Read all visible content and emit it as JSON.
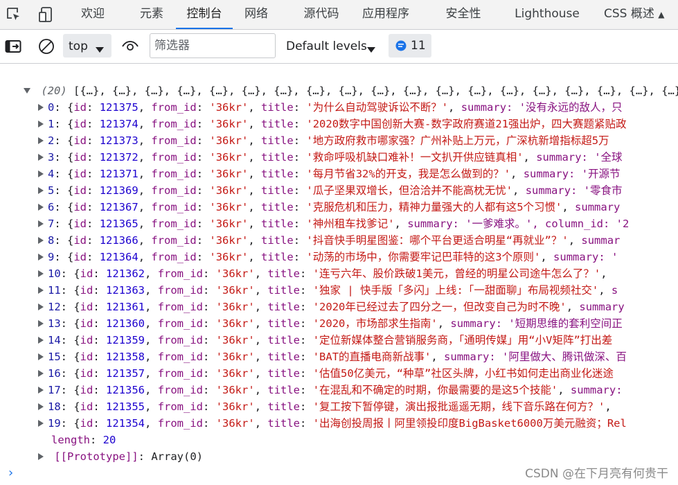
{
  "tabs": [
    {
      "label": "欢迎",
      "active": false
    },
    {
      "label": "元素",
      "active": false
    },
    {
      "label": "控制台",
      "active": true
    },
    {
      "label": "网络",
      "active": false
    },
    {
      "label": "源代码",
      "active": false
    },
    {
      "label": "应用程序",
      "active": false
    },
    {
      "label": "安全性",
      "active": false
    },
    {
      "label": "Lighthouse",
      "active": false
    },
    {
      "label": "CSS 概述",
      "active": false
    }
  ],
  "toolbar": {
    "context": "top",
    "filter_placeholder": "筛选器",
    "levels": "Default levels",
    "issues_count": "11"
  },
  "console": {
    "summary_count": "(20)",
    "summary_preview": "[{…}, {…}, {…}, {…}, {…}, {…}, {…}, {…}, {…}, {…}, {…}, {…}, {…}, {…}, {…}, {…}, {…}, {…}, {…}, {…}]",
    "items": [
      {
        "index": "0",
        "id": "121375",
        "title": "'为什么自动驾驶诉讼不断？'",
        "rest": "summary: '没有永远的敌人，只"
      },
      {
        "index": "1",
        "id": "121374",
        "title": "'2020数字中国创新大赛-数字政府赛道21强出炉，四大赛题紧贴政"
      },
      {
        "index": "2",
        "id": "121373",
        "title": "'地方政府救市哪家强？广州补贴上万元，广深杭新增指标超5万"
      },
      {
        "index": "3",
        "id": "121372",
        "title": "'救命呼吸机缺口难补！一文扒开供应链真相'",
        "rest": "summary: '全球"
      },
      {
        "index": "4",
        "id": "121371",
        "title": "'每月节省32%的开支，我是怎么做到的？'",
        "rest": "summary: '开源节"
      },
      {
        "index": "5",
        "id": "121369",
        "title": "'瓜子坚果双增长，但洽洽并不能高枕无忧'",
        "rest": "summary: '零食市"
      },
      {
        "index": "6",
        "id": "121367",
        "title": "'克服危机和压力，精神力量强大的人都有这5个习惯'",
        "rest": "summary"
      },
      {
        "index": "7",
        "id": "121365",
        "title": "'神州租车找爹记'",
        "rest": "summary: '一爹难求。', column_id: '2"
      },
      {
        "index": "8",
        "id": "121366",
        "title": "'抖音快手明星图鉴：哪个平台更适合明星“再就业”？'",
        "rest": "summar"
      },
      {
        "index": "9",
        "id": "121364",
        "title": "'动荡的市场中，你需要牢记巴菲特的这3个原则'",
        "rest": "summary: '"
      },
      {
        "index": "10",
        "id": "121362",
        "title": "'连亏六年、股价跌破1美元，曾经的明星公司途牛怎么了？'",
        "rest": ""
      },
      {
        "index": "11",
        "id": "121363",
        "title": "'独家 | 快手版「多闪」上线:「一甜面聊」布局视频社交'",
        "rest": "s"
      },
      {
        "index": "12",
        "id": "121361",
        "title": "'2020年已经过去了四分之一，但改变自己为时不晚'",
        "rest": "summary"
      },
      {
        "index": "13",
        "id": "121360",
        "title": "'2020，市场部求生指南'",
        "rest": "summary: '短期思维的套利空间正"
      },
      {
        "index": "14",
        "id": "121359",
        "title": "'定位新媒体整合营销服务商，「通明传媒」用“小V矩阵”打出差"
      },
      {
        "index": "15",
        "id": "121358",
        "title": "'BAT的直播电商新战事'",
        "rest": "summary: '阿里做大、腾讯做深、百"
      },
      {
        "index": "16",
        "id": "121357",
        "title": "'估值50亿美元，“种草”社区头牌，小红书如何走出商业化迷途"
      },
      {
        "index": "17",
        "id": "121356",
        "title": "'在混乱和不确定的时期，你最需要的是这5个技能'",
        "rest": "summary:"
      },
      {
        "index": "18",
        "id": "121355",
        "title": "'复工按下暂停键，演出报批遥遥无期，线下音乐路在何方？'",
        "rest": ""
      },
      {
        "index": "19",
        "id": "121354",
        "title": "'出海创投周报丨阿里领投印度BigBasket6000万美元融资；Rel"
      }
    ],
    "from_id": "'36kr'",
    "length_label": "length",
    "length_value": "20",
    "prototype_label": "[[Prototype]]",
    "prototype_value": "Array(0)"
  },
  "watermark": "CSDN @在下月亮有何贵干"
}
